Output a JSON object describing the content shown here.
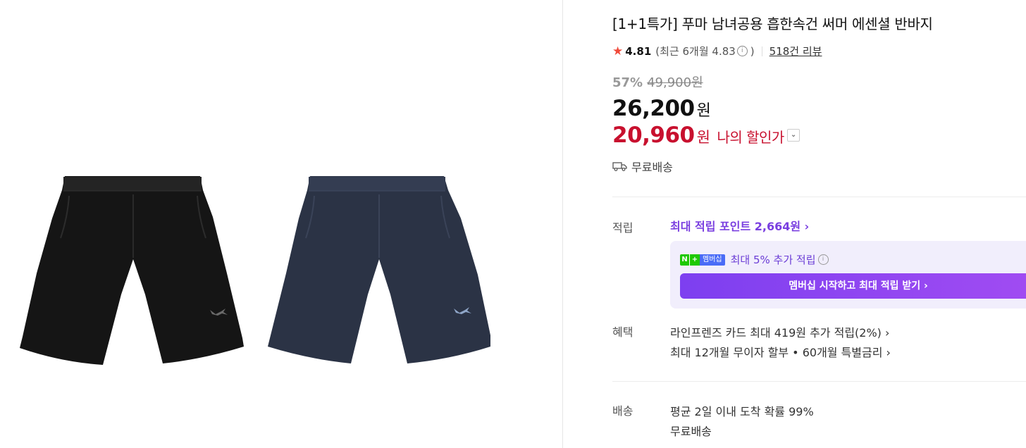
{
  "product": {
    "title": "[1+1특가] 푸마 남녀공용 흡한속건 써머 에센셜 반바지",
    "rating": {
      "score": "4.81",
      "recent": "(최근 6개월 4.83",
      "recent_close": ")",
      "reviews": "518건 리뷰"
    },
    "discount_rate": "57%",
    "original_price": "49,900원",
    "price": "26,200",
    "price_unit": "원",
    "my_price": "20,960",
    "my_price_unit": "원",
    "my_price_label": "나의 할인가",
    "free_shipping": "무료배송"
  },
  "points": {
    "label": "적립",
    "max_points": "최대 적립 포인트 2,664원 ›",
    "badge_n": "N",
    "badge_plus": "+",
    "badge_text": "멤버십",
    "extra": "최대 5% 추가 적립",
    "cta": "멤버십 시작하고 최대 적립 받기 ›"
  },
  "benefits": {
    "label": "혜택",
    "items": [
      "라인프렌즈 카드 최대 419원 추가 적립(2%) ›",
      "최대 12개월 무이자 할부 • 60개월 특별금리 ›"
    ]
  },
  "delivery": {
    "label": "배송",
    "eta": "평균 2일 이내 도착 확률 99%",
    "fee": "무료배송"
  },
  "colors": {
    "accent_red": "#c8102e",
    "accent_purple": "#7a3fe0",
    "star": "#f04a3a"
  }
}
